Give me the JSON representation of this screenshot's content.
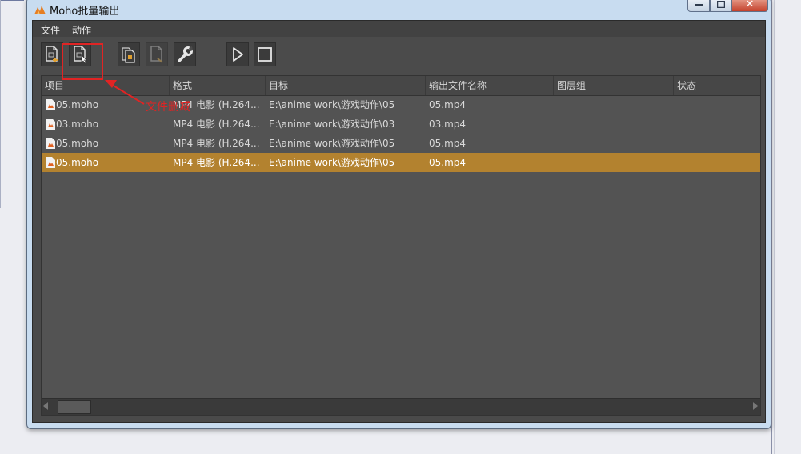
{
  "window": {
    "title": "Moho批量输出",
    "controls": {
      "minimize": "minimize",
      "maximize": "maximize",
      "close": "✕"
    }
  },
  "menu": [
    {
      "label": "文件"
    },
    {
      "label": "动作"
    }
  ],
  "toolbar": {
    "buttons": [
      {
        "name": "add-file",
        "icon": "file-add-icon"
      },
      {
        "name": "add-file-cursor",
        "icon": "file-select-icon"
      },
      {
        "name": "duplicate",
        "icon": "copy-icon"
      },
      {
        "name": "remove",
        "icon": "file-remove-icon"
      },
      {
        "name": "settings",
        "icon": "wrench-icon"
      },
      {
        "name": "play",
        "icon": "play-icon"
      },
      {
        "name": "stop",
        "icon": "stop-icon"
      }
    ]
  },
  "table": {
    "columns": [
      "项目",
      "格式",
      "目标",
      "输出文件名称",
      "图层组",
      "状态"
    ],
    "rows": [
      {
        "project": "05.moho",
        "format": "MP4 电影 (H.264...",
        "target": "E:\\anime work\\游戏动作\\05",
        "output": "05.mp4",
        "layers": "",
        "status": "",
        "selected": false
      },
      {
        "project": "03.moho",
        "format": "MP4 电影 (H.264...",
        "target": "E:\\anime work\\游戏动作\\03",
        "output": "03.mp4",
        "layers": "",
        "status": "",
        "selected": false
      },
      {
        "project": "05.moho",
        "format": "MP4 电影 (H.264...",
        "target": "E:\\anime work\\游戏动作\\05",
        "output": "05.mp4",
        "layers": "",
        "status": "",
        "selected": false
      },
      {
        "project": "05.moho",
        "format": "MP4 电影 (H.264...",
        "target": "E:\\anime work\\游戏动作\\05",
        "output": "05.mp4",
        "layers": "",
        "status": "",
        "selected": true
      }
    ]
  },
  "annotation": {
    "text": "文件删减",
    "color": "#e02424"
  },
  "colors": {
    "selection": "#b3822f",
    "panel": "#4a4a4a"
  }
}
